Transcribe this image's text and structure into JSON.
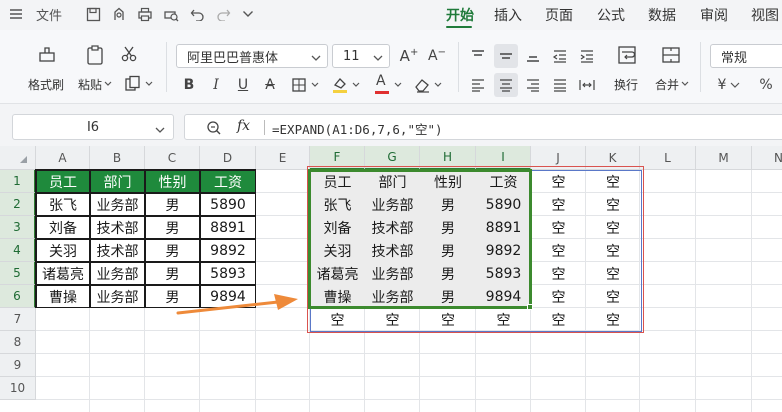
{
  "menu": {
    "file_label": "文件",
    "tabs": [
      "开始",
      "插入",
      "页面",
      "公式",
      "数据",
      "审阅",
      "视图"
    ],
    "active_tab": "开始"
  },
  "ribbon": {
    "format_painter": "格式刷",
    "paste": "粘贴",
    "font_name": "阿里巴巴普惠体",
    "font_size": "11",
    "wrap_text": "换行",
    "merge": "合并",
    "number_format": "常规",
    "currency_symbol": "¥",
    "percent_symbol": "%",
    "bold": "B",
    "italic": "I",
    "underline": "U",
    "strikethrough": "A",
    "font_color_letter": "A",
    "grow_font": "A",
    "shrink_font": "A"
  },
  "formula_bar": {
    "cell_ref": "I6",
    "fx_label": "fx",
    "formula": "=EXPAND(A1:D6,7,6,\"空\")"
  },
  "columns": [
    "A",
    "B",
    "C",
    "D",
    "E",
    "F",
    "G",
    "H",
    "I",
    "J",
    "K",
    "L",
    "M",
    "N"
  ],
  "rows": [
    "1",
    "2",
    "3",
    "4",
    "5",
    "6",
    "7",
    "8",
    "9",
    "10"
  ],
  "source_table": {
    "header": [
      "员工",
      "部门",
      "性别",
      "工资"
    ],
    "rows": [
      [
        "张飞",
        "业务部",
        "男",
        "5890"
      ],
      [
        "刘备",
        "技术部",
        "男",
        "8891"
      ],
      [
        "关羽",
        "技术部",
        "男",
        "9892"
      ],
      [
        "诸葛亮",
        "业务部",
        "男",
        "5893"
      ],
      [
        "曹操",
        "业务部",
        "男",
        "9894"
      ]
    ]
  },
  "result_table": {
    "rows": [
      [
        "员工",
        "部门",
        "性别",
        "工资",
        "空",
        "空"
      ],
      [
        "张飞",
        "业务部",
        "男",
        "5890",
        "空",
        "空"
      ],
      [
        "刘备",
        "技术部",
        "男",
        "8891",
        "空",
        "空"
      ],
      [
        "关羽",
        "技术部",
        "男",
        "9892",
        "空",
        "空"
      ],
      [
        "诸葛亮",
        "业务部",
        "男",
        "5893",
        "空",
        "空"
      ],
      [
        "曹操",
        "业务部",
        "男",
        "9894",
        "空",
        "空"
      ],
      [
        "空",
        "空",
        "空",
        "空",
        "空",
        "空"
      ]
    ]
  },
  "colors": {
    "accent_green": "#1f7a3a",
    "header_fill": "#1f8a3c",
    "spill_border": "#3c8a2e",
    "arrow_orange": "#ee8a3a",
    "outline_red": "#d9534f",
    "outline_blue": "#5a78c8"
  },
  "icons": [
    "menu-icon",
    "save-icon",
    "undo-icon",
    "redo-icon",
    "print-icon",
    "cut-icon",
    "paste-icon",
    "copy-icon",
    "zoom-icon",
    "wrap-icon",
    "merge-icon"
  ]
}
